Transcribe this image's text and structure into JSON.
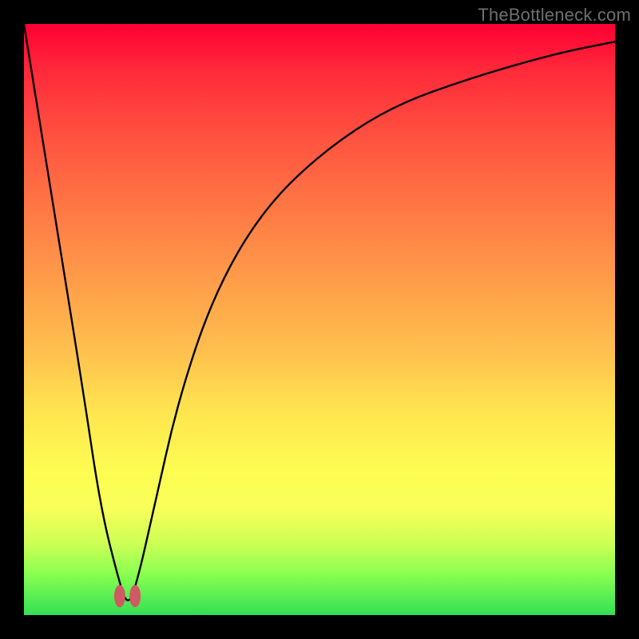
{
  "watermark": "TheBottleneck.com",
  "chart_data": {
    "type": "line",
    "title": "",
    "xlabel": "",
    "ylabel": "",
    "xlim": [
      0,
      100
    ],
    "ylim": [
      0,
      100
    ],
    "grid": false,
    "legend": false,
    "series": [
      {
        "name": "bottleneck-curve",
        "x": [
          0,
          5,
          10,
          13,
          16,
          17.5,
          19,
          22,
          26,
          32,
          40,
          50,
          62,
          76,
          90,
          100
        ],
        "values": [
          100,
          69,
          38,
          18,
          6,
          1.5,
          5,
          18,
          36,
          54,
          68,
          78,
          86,
          91,
          95,
          97
        ]
      }
    ],
    "markers": [
      {
        "name": "dip-lobe-left",
        "x": 16.2,
        "y": 3.2
      },
      {
        "name": "dip-lobe-right",
        "x": 18.8,
        "y": 3.2
      }
    ],
    "annotations": []
  }
}
